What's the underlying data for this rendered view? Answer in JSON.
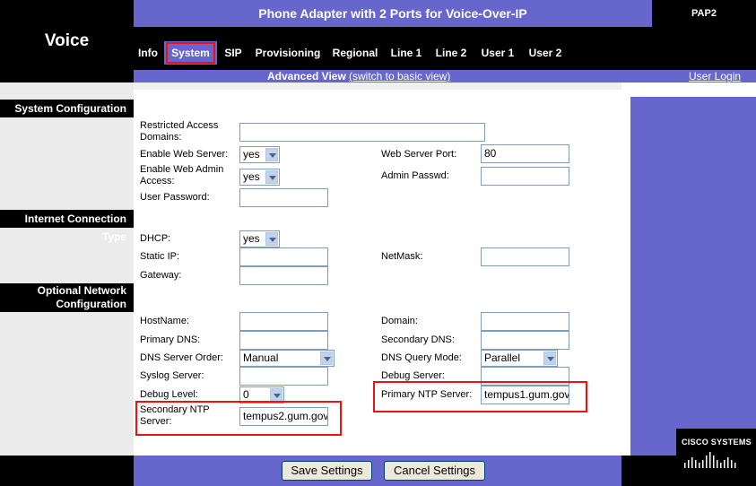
{
  "header": {
    "title": "Phone Adapter with 2 Ports for Voice-Over-IP",
    "model": "PAP2",
    "app_name": "Voice"
  },
  "tabs": [
    {
      "label": "Info"
    },
    {
      "label": "System",
      "active": true
    },
    {
      "label": "SIP"
    },
    {
      "label": "Provisioning"
    },
    {
      "label": "Regional"
    },
    {
      "label": "Line 1"
    },
    {
      "label": "Line 2"
    },
    {
      "label": "User 1"
    },
    {
      "label": "User 2"
    }
  ],
  "view_bar": {
    "current": "Advanced View",
    "switch_link": "(switch to basic view)",
    "user_login": "User Login"
  },
  "sections": {
    "system_configuration": "System Configuration",
    "internet_connection_type": "Internet Connection Type",
    "optional_network_1": "Optional Network",
    "optional_network_2": "Configuration"
  },
  "system_config": {
    "restricted_access_label_1": "Restricted Access",
    "restricted_access_label_2": "Domains:",
    "restricted_access_value": "",
    "enable_web_server_label": "Enable Web Server:",
    "enable_web_server_value": "yes",
    "web_server_port_label": "Web Server Port:",
    "web_server_port_value": "80",
    "enable_web_admin_label_1": "Enable Web Admin",
    "enable_web_admin_label_2": "Access:",
    "enable_web_admin_value": "yes",
    "admin_passwd_label": "Admin Passwd:",
    "admin_passwd_value": "",
    "user_password_label": "User Password:",
    "user_password_value": ""
  },
  "internet_connection": {
    "dhcp_label": "DHCP:",
    "dhcp_value": "yes",
    "static_ip_label": "Static IP:",
    "static_ip_value": "",
    "netmask_label": "NetMask:",
    "netmask_value": "",
    "gateway_label": "Gateway:",
    "gateway_value": ""
  },
  "optional_network": {
    "hostname_label": "HostName:",
    "hostname_value": "",
    "domain_label": "Domain:",
    "domain_value": "",
    "primary_dns_label": "Primary DNS:",
    "primary_dns_value": "",
    "secondary_dns_label": "Secondary DNS:",
    "secondary_dns_value": "",
    "dns_server_order_label": "DNS Server Order:",
    "dns_server_order_value": "Manual",
    "dns_query_mode_label": "DNS Query Mode:",
    "dns_query_mode_value": "Parallel",
    "syslog_server_label": "Syslog Server:",
    "syslog_server_value": "",
    "debug_server_label": "Debug Server:",
    "debug_server_value": "",
    "debug_level_label": "Debug Level:",
    "debug_level_value": "0",
    "primary_ntp_label": "Primary NTP Server:",
    "primary_ntp_value": "tempus1.gum.gov",
    "secondary_ntp_label_1": "Secondary NTP",
    "secondary_ntp_label_2": "Server:",
    "secondary_ntp_value": "tempus2.gum.gov"
  },
  "footer": {
    "save_label": "Save Settings",
    "cancel_label": "Cancel Settings",
    "brand": "Cisco Systems"
  },
  "colors": {
    "accent": "#6666cc",
    "highlight": "#ee1111"
  }
}
